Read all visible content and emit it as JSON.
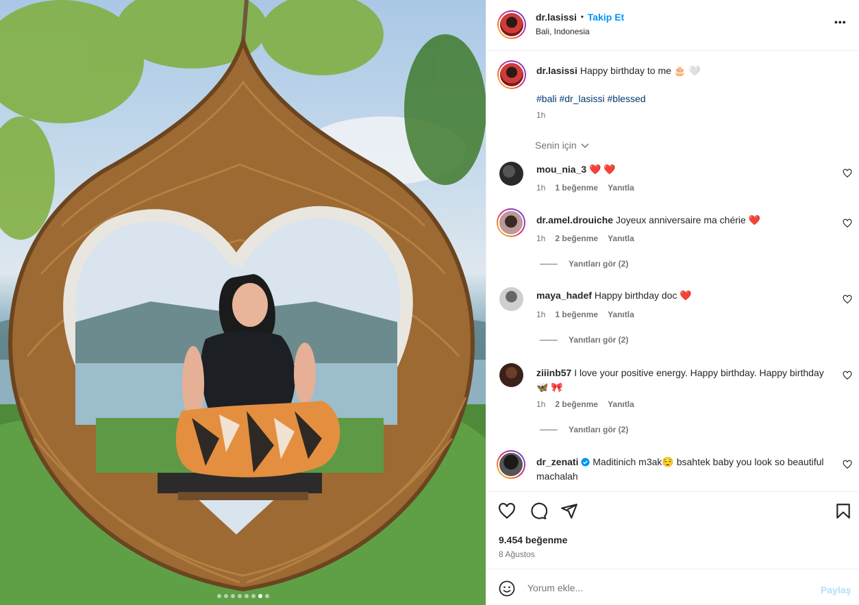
{
  "post": {
    "username": "dr.lasissi",
    "follow_separator": "•",
    "follow_label": "Takip Et",
    "location": "Bali, Indonesia",
    "more_label": "•••"
  },
  "caption": {
    "username": "dr.lasissi",
    "text": "Happy birthday to me 🎂 🤍",
    "hashtags": "#bali #dr_lasissi #blessed",
    "time": "1h"
  },
  "sort": {
    "label": "Senin için"
  },
  "comments": [
    {
      "username": "mou_nia_3",
      "text": "❤️ ❤️",
      "time": "1h",
      "likes": "1 beğenme",
      "reply": "Yanıtla",
      "view_replies": ""
    },
    {
      "username": "dr.amel.drouiche",
      "text": "Joyeux anniversaire ma chérie ❤️",
      "time": "1h",
      "likes": "2 beğenme",
      "reply": "Yanıtla",
      "view_replies": "Yanıtları gör (2)"
    },
    {
      "username": "maya_hadef",
      "text": "Happy birthday doc ❤️",
      "time": "1h",
      "likes": "1 beğenme",
      "reply": "Yanıtla",
      "view_replies": "Yanıtları gör (2)"
    },
    {
      "username": "ziiinb57",
      "text": "I love your positive energy. Happy birthday. Happy birthday 🦋 🎀",
      "time": "1h",
      "likes": "2 beğenme",
      "reply": "Yanıtla",
      "view_replies": "Yanıtları gör (2)"
    },
    {
      "username": "dr_zenati",
      "text": "Maditinich m3ak😌 bsahtek baby you look so beautiful machalah",
      "time": "",
      "likes": "",
      "reply": "",
      "view_replies": ""
    }
  ],
  "stats": {
    "likes": "9.454 beğenme",
    "date": "8 Ağustos"
  },
  "comment_box": {
    "placeholder": "Yorum ekle...",
    "post_label": "Paylaş"
  },
  "carousel": {
    "count": 8,
    "active": 6
  },
  "colors": {
    "accent": "#0095f6",
    "like_red": "#ed1c24",
    "hashtag": "#00376b"
  }
}
